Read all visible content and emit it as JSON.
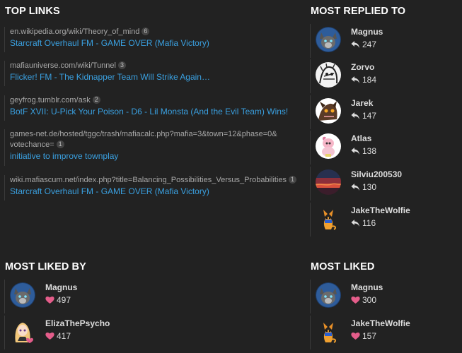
{
  "top_links": {
    "title": "TOP LINKS",
    "items": [
      {
        "domain": "en.wikipedia.org/wiki/Theory_of_mind",
        "count": "6",
        "title": "Starcraft Overhaul FM - GAME OVER (Mafia Victory)"
      },
      {
        "domain": "mafiauniverse.com/wiki/Tunnel",
        "count": "3",
        "title": "Flicker! FM - The Kidnapper Team Will Strike Again…"
      },
      {
        "domain": "geyfrog.tumblr.com/ask",
        "count": "2",
        "title": "BotF XVII: U-Pick Your Poison - D6 - Lil Monsta (And the Evil Team) Wins!"
      },
      {
        "domain": "games-net.de/hosted/tggc/trash/mafiacalc.php?mafia=3&town=12&phase=0&",
        "domain_line2": "votechance=",
        "count": "1",
        "title": "initiative to improve townplay"
      },
      {
        "domain": "wiki.mafiascum.net/index.php?title=Balancing_Possibilities_Versus_Probabilities",
        "count": "1",
        "title": "Starcraft Overhaul FM - GAME OVER (Mafia Victory)"
      }
    ]
  },
  "most_replied_to": {
    "title": "MOST REPLIED TO",
    "users": [
      {
        "name": "Magnus",
        "count": "247",
        "avatar": "wolf"
      },
      {
        "name": "Zorvo",
        "count": "184",
        "avatar": "sketch"
      },
      {
        "name": "Jarek",
        "count": "147",
        "avatar": "creature"
      },
      {
        "name": "Atlas",
        "count": "138",
        "avatar": "pink-pony"
      },
      {
        "name": "Silviu200530",
        "count": "130",
        "avatar": "sunset"
      },
      {
        "name": "JakeTheWolfie",
        "count": "116",
        "avatar": "fox"
      }
    ]
  },
  "most_liked_by": {
    "title": "MOST LIKED BY",
    "users": [
      {
        "name": "Magnus",
        "count": "497",
        "avatar": "wolf"
      },
      {
        "name": "ElizaThePsycho",
        "count": "417",
        "avatar": "anime-girl"
      }
    ]
  },
  "most_liked": {
    "title": "MOST LIKED",
    "users": [
      {
        "name": "Magnus",
        "count": "300",
        "avatar": "wolf"
      },
      {
        "name": "JakeTheWolfie",
        "count": "157",
        "avatar": "fox"
      }
    ]
  },
  "colors": {
    "background": "#222222",
    "link": "#3aa0e0",
    "heart": "#e45d8a",
    "text": "#dddddd"
  }
}
